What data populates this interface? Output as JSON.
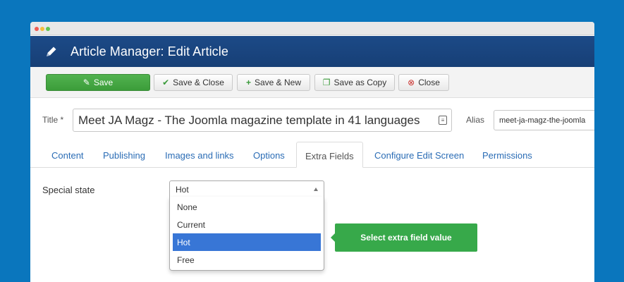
{
  "header": {
    "title": "Article Manager: Edit Article",
    "icon": "pencil-icon"
  },
  "toolbar": {
    "save": {
      "label": "Save",
      "icon": "edit-icon"
    },
    "save_close": {
      "label": "Save & Close",
      "icon": "check-icon"
    },
    "save_new": {
      "label": "Save & New",
      "icon": "plus-icon"
    },
    "save_copy": {
      "label": "Save as Copy",
      "icon": "copy-icon"
    },
    "close": {
      "label": "Close",
      "icon": "close-circle-icon"
    }
  },
  "form": {
    "title_label": "Title *",
    "title_value": "Meet JA Magz - The Joomla magazine template in 41 languages",
    "alias_label": "Alias",
    "alias_value": "meet-ja-magz-the-joomla"
  },
  "tabs": [
    "Content",
    "Publishing",
    "Images and links",
    "Options",
    "Extra Fields",
    "Configure Edit Screen",
    "Permissions"
  ],
  "active_tab": "Extra Fields",
  "extra_fields": {
    "label": "Special state",
    "selected": "Hot",
    "options": [
      "None",
      "Current",
      "Hot",
      "Free"
    ]
  },
  "tooltip": "Select extra field value",
  "colors": {
    "background": "#0a76bd",
    "header": "#1c4a87",
    "save": "#46a844",
    "tooltip": "#37a94a",
    "selected_option": "#3876d6"
  }
}
